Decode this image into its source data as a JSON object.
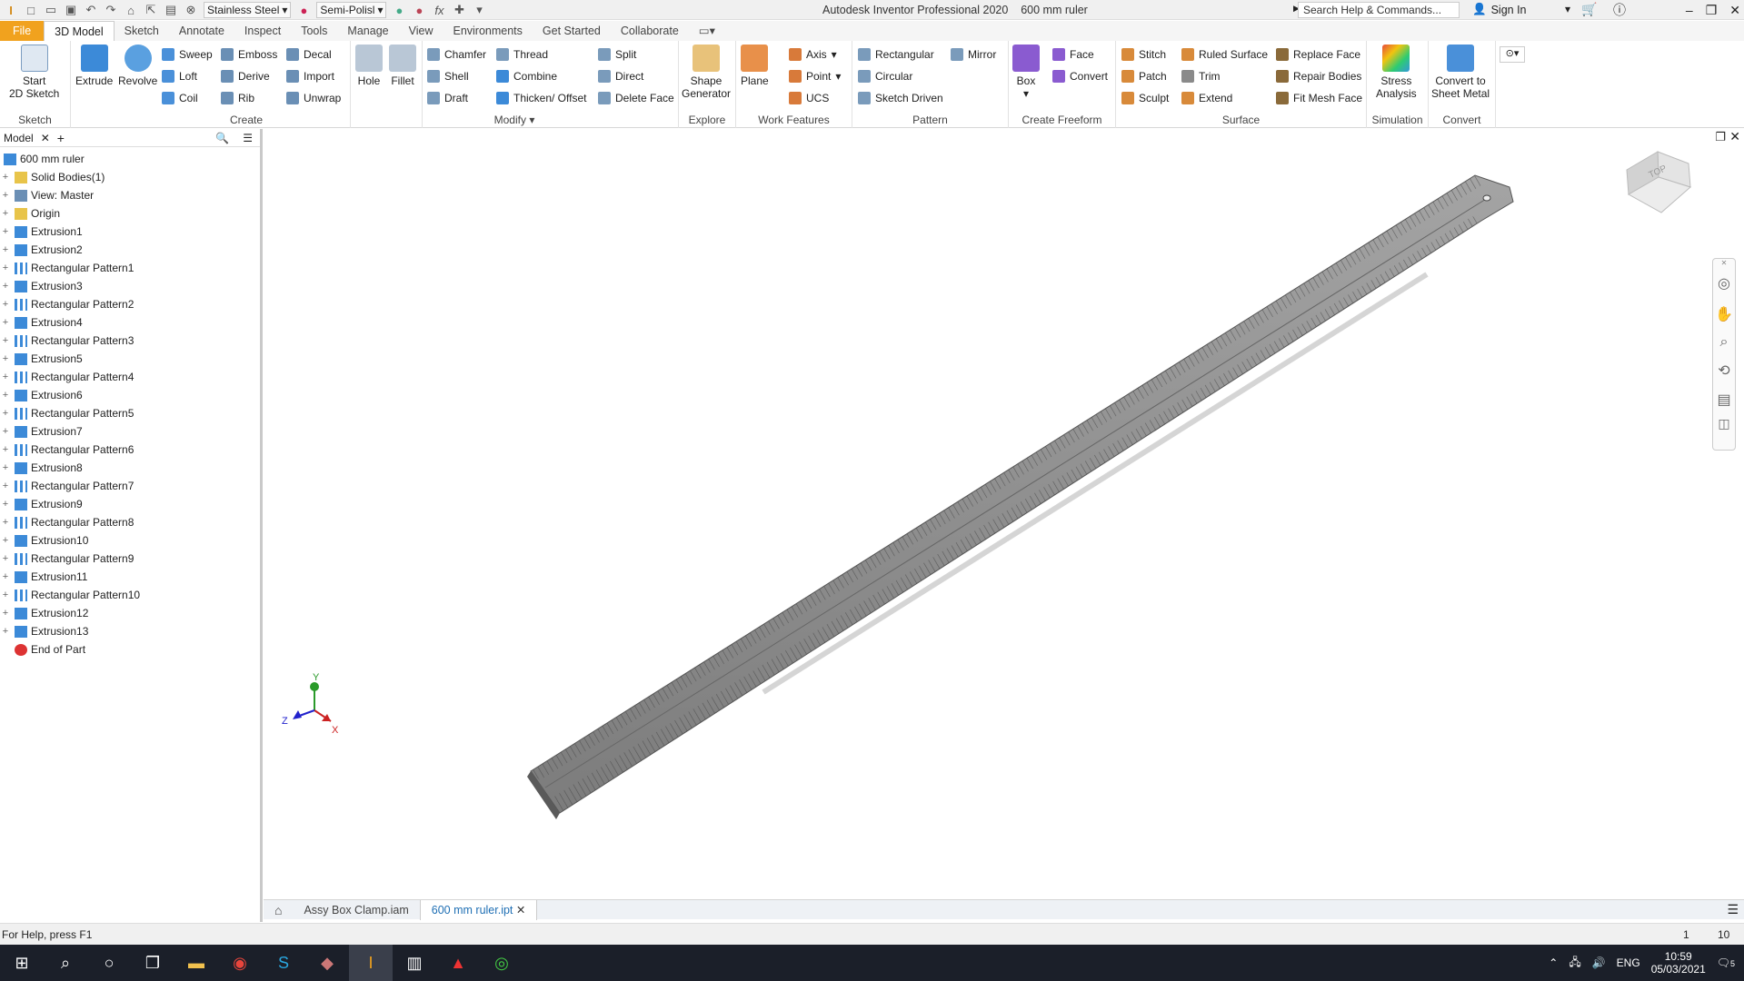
{
  "titlebar": {
    "material": "Stainless Steel",
    "appearance": "Semi-Polisl",
    "app_title": "Autodesk Inventor Professional 2020",
    "doc_title": "600 mm ruler",
    "search_placeholder": "Search Help & Commands...",
    "signin": "Sign In"
  },
  "tabs": [
    "File",
    "3D Model",
    "Sketch",
    "Annotate",
    "Inspect",
    "Tools",
    "Manage",
    "View",
    "Environments",
    "Get Started",
    "Collaborate"
  ],
  "ribbon": {
    "sketch": {
      "label": "Sketch",
      "start": "Start",
      "start2": "2D Sketch"
    },
    "create": {
      "label": "Create",
      "extrude": "Extrude",
      "revolve": "Revolve",
      "sweep": "Sweep",
      "loft": "Loft",
      "coil": "Coil",
      "emboss": "Emboss",
      "derive": "Derive",
      "rib": "Rib",
      "decal": "Decal",
      "import": "Import",
      "unwrap": "Unwrap"
    },
    "modify": {
      "label": "Modify",
      "hole": "Hole",
      "fillet": "Fillet",
      "chamfer": "Chamfer",
      "shell": "Shell",
      "draft": "Draft",
      "thread": "Thread",
      "combine": "Combine",
      "thicken": "Thicken/ Offset",
      "split": "Split",
      "direct": "Direct",
      "delete_face": "Delete Face"
    },
    "explore": {
      "label": "Explore",
      "shape1": "Shape",
      "shape2": "Generator"
    },
    "work": {
      "label": "Work Features",
      "plane": "Plane",
      "axis": "Axis",
      "point": "Point",
      "ucs": "UCS"
    },
    "pattern": {
      "label": "Pattern",
      "rect": "Rectangular",
      "circ": "Circular",
      "sketch": "Sketch Driven",
      "mirror": "Mirror"
    },
    "freeform": {
      "label": "Create Freeform",
      "box": "Box",
      "face": "Face",
      "convert": "Convert"
    },
    "surface": {
      "label": "Surface",
      "stitch": "Stitch",
      "patch": "Patch",
      "sculpt": "Sculpt",
      "ruled": "Ruled Surface",
      "trim": "Trim",
      "extend": "Extend",
      "replace": "Replace Face",
      "repair": "Repair Bodies",
      "fitmesh": "Fit Mesh Face"
    },
    "simulation": {
      "label": "Simulation",
      "s1": "Stress",
      "s2": "Analysis"
    },
    "convert": {
      "label": "Convert",
      "c1": "Convert to",
      "c2": "Sheet Metal"
    }
  },
  "browser": {
    "tab": "Model",
    "root": "600 mm ruler",
    "items": [
      "Solid Bodies(1)",
      "View: Master",
      "Origin",
      "Extrusion1",
      "Extrusion2",
      "Rectangular Pattern1",
      "Extrusion3",
      "Rectangular Pattern2",
      "Extrusion4",
      "Rectangular Pattern3",
      "Extrusion5",
      "Rectangular Pattern4",
      "Extrusion6",
      "Rectangular Pattern5",
      "Extrusion7",
      "Rectangular Pattern6",
      "Extrusion8",
      "Rectangular Pattern7",
      "Extrusion9",
      "Rectangular Pattern8",
      "Extrusion10",
      "Rectangular Pattern9",
      "Extrusion11",
      "Rectangular Pattern10",
      "Extrusion12",
      "Extrusion13",
      "End of Part"
    ]
  },
  "viewcube": {
    "face": "TOP"
  },
  "axes": {
    "x": "X",
    "y": "Y",
    "z": "Z"
  },
  "doctabs": [
    "Assy Box Clamp.iam",
    "600 mm ruler.ipt"
  ],
  "status": {
    "help": "For Help, press F1",
    "n1": "1",
    "n2": "10"
  },
  "tray": {
    "lang": "ENG",
    "time": "10:59",
    "date": "05/03/2021",
    "notif": "5"
  },
  "colors": {
    "accent": "#f1a21e",
    "taskbar": "#1b1f29",
    "ruler": "#8c8c8c"
  }
}
